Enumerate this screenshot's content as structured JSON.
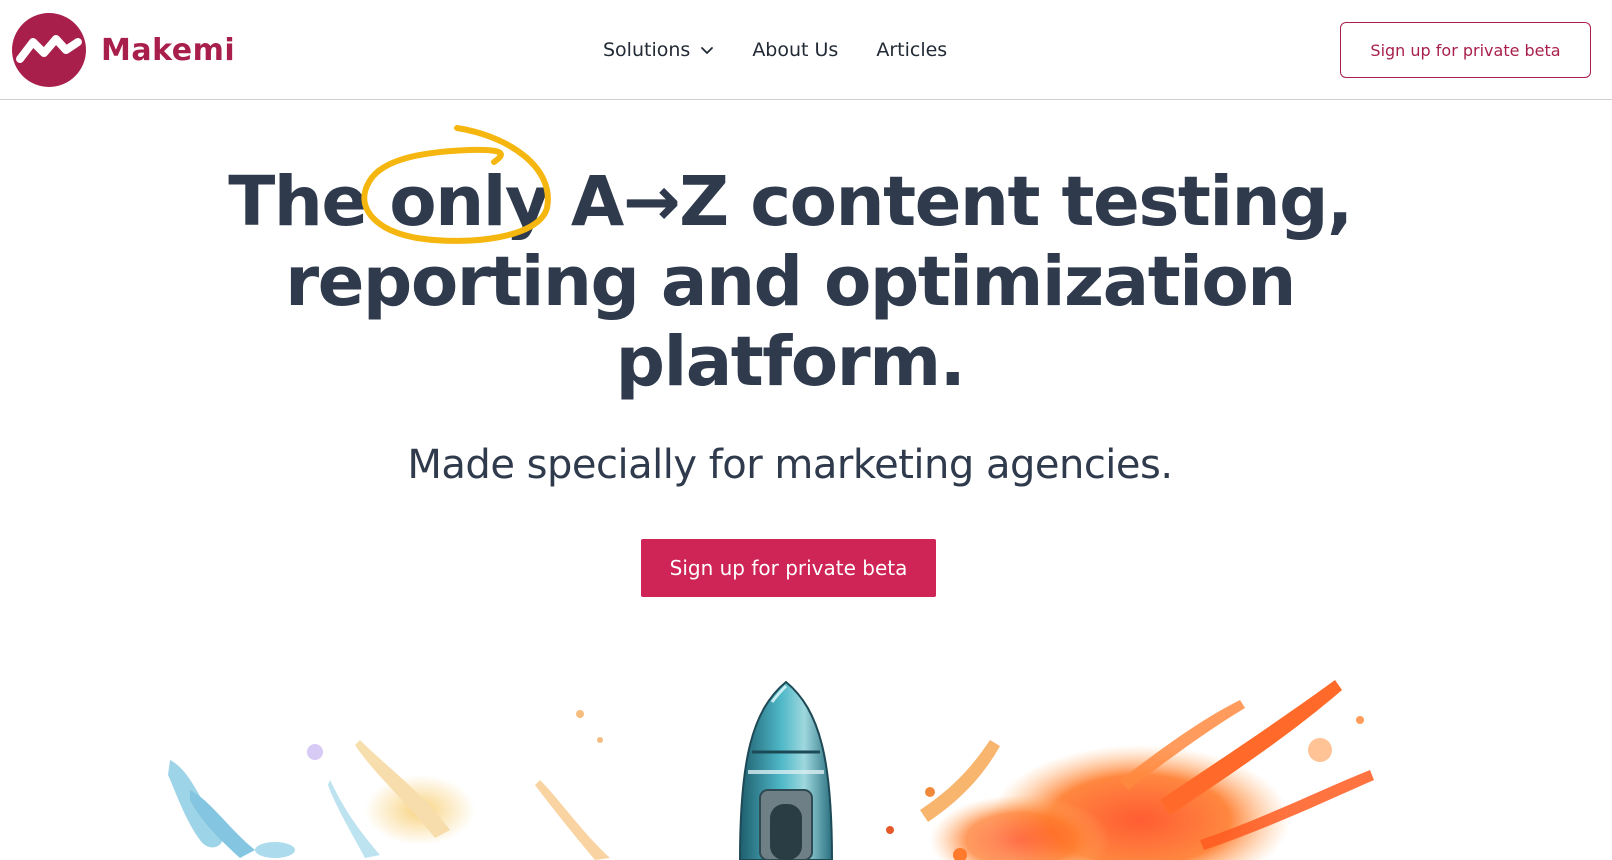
{
  "brand": {
    "name": "Makemi",
    "color": "#a81f4b"
  },
  "nav": {
    "items": [
      {
        "label": "Solutions",
        "has_dropdown": true
      },
      {
        "label": "About Us"
      },
      {
        "label": "Articles"
      }
    ]
  },
  "header_cta": {
    "label": "Sign up for private beta"
  },
  "hero": {
    "headline_line1_before": "The ",
    "headline_highlight": "only",
    "headline_line1_after": " A→Z content testing,",
    "headline_line2": "reporting and optimization",
    "headline_line3": "platform.",
    "subheadline": "Made specially for marketing agencies.",
    "cta_label": "Sign up for private beta",
    "cta_color": "#cf2456",
    "highlight_color": "#f5b70f",
    "text_color": "#2f3a4c"
  },
  "illustration": {
    "subject": "watercolor rocket with paint splashes"
  }
}
